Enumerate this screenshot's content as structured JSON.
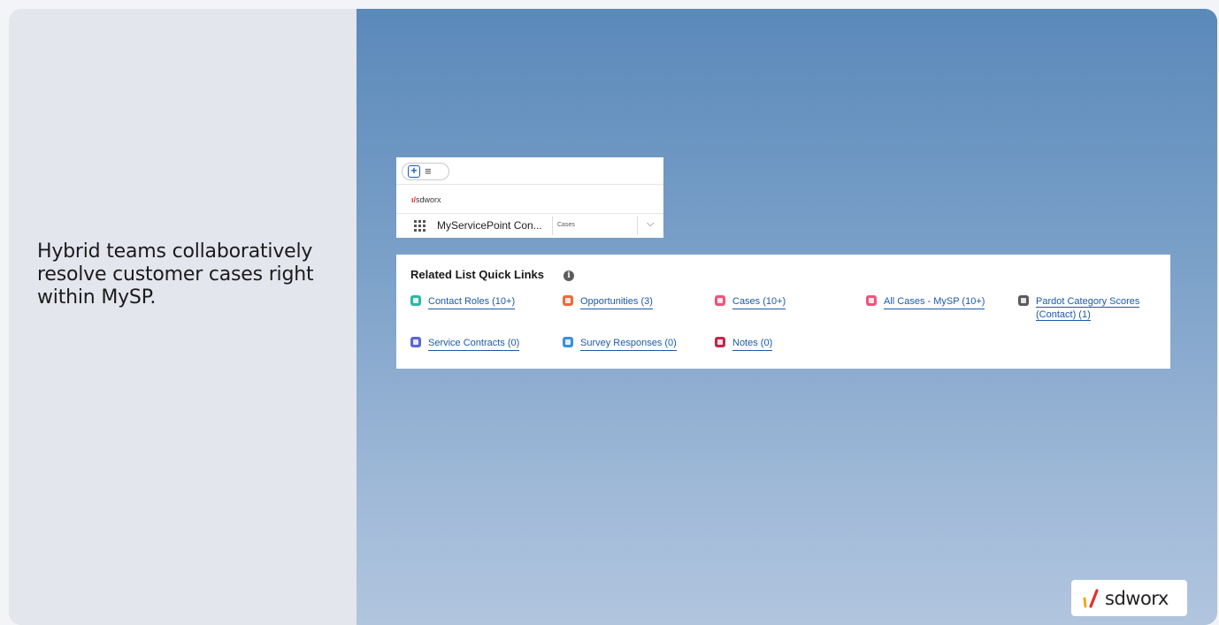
{
  "left_panel": {
    "headline": "Hybrid teams collaboratively resolve customer cases right within MySP."
  },
  "mini_app": {
    "logo_text": "sdworx",
    "app_name": "MyServicePoint Con...",
    "current_tab": "Cases",
    "icons": [
      "add-icon",
      "menu-icon",
      "app-launcher-icon",
      "chevron-down-icon"
    ]
  },
  "related_list": {
    "title": "Related List Quick Links",
    "links": [
      {
        "label": "Contact Roles (10+)",
        "icon": "contact-roles-icon",
        "color": "#2eb8a0"
      },
      {
        "label": "Opportunities (3)",
        "icon": "opportunities-icon",
        "color": "#ef6a3a"
      },
      {
        "label": "Cases (10+)",
        "icon": "cases-icon",
        "color": "#f1547a"
      },
      {
        "label": "All Cases - MySP (10+)",
        "icon": "all-cases-icon",
        "color": "#f1547a"
      },
      {
        "label": "Pardot Category Scores",
        "label_line2": "(Contact) (1)",
        "icon": "pardot-icon",
        "color": "#5b5b5b"
      },
      {
        "label": "Service Contracts (0)",
        "icon": "service-contracts-icon",
        "color": "#5b64d6"
      },
      {
        "label": "Survey Responses (0)",
        "icon": "survey-responses-icon",
        "color": "#3b8fe0"
      },
      {
        "label": "Notes (0)",
        "icon": "notes-icon",
        "color": "#c1264c"
      }
    ]
  },
  "brand": {
    "name": "sdworx",
    "colors": [
      "#e0322f",
      "#f3a51c"
    ]
  }
}
